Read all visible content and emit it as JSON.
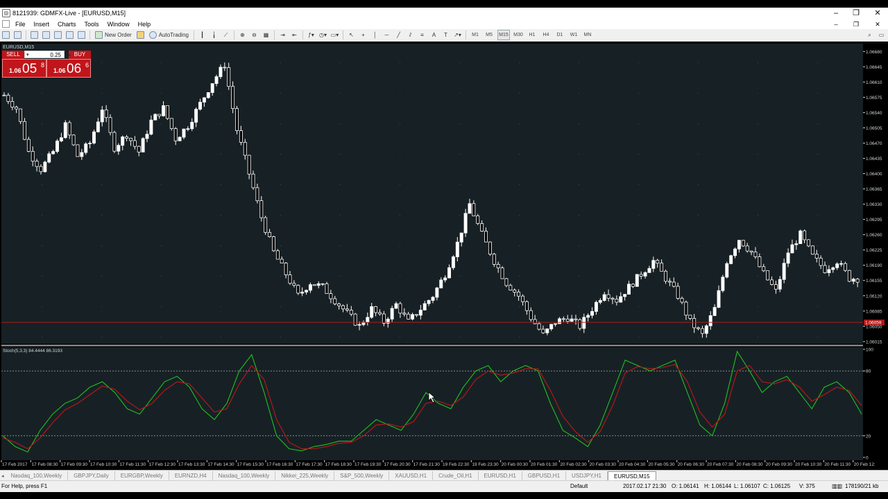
{
  "window": {
    "title": "8121939: GDMFX-Live - [EURUSD,M15]",
    "controls": [
      "–",
      "❐",
      "✕"
    ],
    "doc_controls": [
      "–",
      "❐",
      "✕"
    ]
  },
  "menu": [
    "File",
    "Insert",
    "Charts",
    "Tools",
    "Window",
    "Help"
  ],
  "toolbar": {
    "new_order": "New Order",
    "auto_trading": "AutoTrading",
    "timeframes": [
      "M1",
      "M5",
      "M15",
      "M30",
      "H1",
      "H4",
      "D1",
      "W1",
      "MN"
    ],
    "active_timeframe": "M15"
  },
  "chart": {
    "symbol_label": "EURUSD,M15",
    "indicator_label": "Stoch(5,3,3) 84.4444 86.3193",
    "current_price_label": "1.06059",
    "colors": {
      "background": "#000000",
      "candle_bull": "#ffffff",
      "candle_bear": "#000000",
      "price_line": "#b11a1a",
      "stoch_main": "#22c022",
      "stoch_signal": "#c0161b"
    }
  },
  "one_click": {
    "sell_label": "SELL",
    "buy_label": "BUY",
    "lot": "0.25",
    "sell_small": "1.06",
    "sell_big": "05",
    "sell_sup": "8",
    "buy_small": "1.06",
    "buy_big": "06",
    "buy_sup": "6"
  },
  "chart_data": [
    {
      "type": "candlestick",
      "title": "EURUSD,M15",
      "y_ticks": [
        "1.06680",
        "1.06645",
        "1.06610",
        "1.06575",
        "1.06540",
        "1.06505",
        "1.06470",
        "1.06435",
        "1.06400",
        "1.06365",
        "1.06330",
        "1.06295",
        "1.06260",
        "1.06225",
        "1.06190",
        "1.06155",
        "1.06120",
        "1.06085",
        "1.06050",
        "1.06015"
      ],
      "ylim": [
        1.0601,
        1.0669
      ],
      "x_ticks": [
        "17 Feb 2017",
        "17 Feb 08:30",
        "17 Feb 09:30",
        "17 Feb 10:30",
        "17 Feb 11:30",
        "17 Feb 12:30",
        "17 Feb 13:30",
        "17 Feb 14:30",
        "17 Feb 15:30",
        "17 Feb 16:30",
        "17 Feb 17:30",
        "17 Feb 18:30",
        "17 Feb 19:30",
        "17 Feb 20:30",
        "17 Feb 21:30",
        "19 Feb 22:30",
        "19 Feb 23:30",
        "20 Feb 00:30",
        "20 Feb 01:30",
        "20 Feb 02:30",
        "20 Feb 03:30",
        "20 Feb 04:30",
        "20 Feb 05:30",
        "20 Feb 06:30",
        "20 Feb 07:30",
        "20 Feb 08:30",
        "20 Feb 09:30",
        "20 Feb 10:30",
        "20 Feb 11:30",
        "20 Feb 12:"
      ],
      "current_price": 1.06059,
      "close_path": [
        1.0658,
        1.0655,
        1.0645,
        1.0641,
        1.0645,
        1.0651,
        1.0644,
        1.0647,
        1.0655,
        1.0646,
        1.0649,
        1.0645,
        1.0652,
        1.0655,
        1.0648,
        1.0651,
        1.0656,
        1.0661,
        1.0665,
        1.065,
        1.064,
        1.063,
        1.0622,
        1.0617,
        1.0612,
        1.0615,
        1.0614,
        1.0611,
        1.0608,
        1.0605,
        1.0609,
        1.0606,
        1.061,
        1.0606,
        1.0609,
        1.0612,
        1.0617,
        1.0624,
        1.0633,
        1.0626,
        1.062,
        1.0615,
        1.0612,
        1.0607,
        1.0603,
        1.0606,
        1.0607,
        1.0605,
        1.0609,
        1.0613,
        1.0611,
        1.0614,
        1.0617,
        1.062,
        1.0616,
        1.0612,
        1.0606,
        1.0603,
        1.0609,
        1.062,
        1.0625,
        1.0622,
        1.0617,
        1.0613,
        1.0622,
        1.0626,
        1.0621,
        1.0618,
        1.062,
        1.0616
      ]
    },
    {
      "type": "line",
      "title": "Stoch(5,3,3) 84.4444 86.3193",
      "ylim": [
        0,
        100
      ],
      "y_ticks": [
        "100",
        "80",
        "20",
        "0"
      ],
      "levels": [
        80,
        20
      ],
      "series": [
        {
          "values": [
            20,
            10,
            5,
            25,
            40,
            50,
            55,
            65,
            70,
            60,
            45,
            40,
            55,
            70,
            75,
            65,
            45,
            35,
            50,
            80,
            95,
            60,
            20,
            8,
            6,
            10,
            12,
            15,
            15,
            25,
            35,
            30,
            25,
            40,
            60,
            50,
            45,
            65,
            80,
            85,
            70,
            80,
            85,
            80,
            50,
            25,
            18,
            10,
            30,
            60,
            90,
            85,
            80,
            85,
            90,
            60,
            30,
            20,
            50,
            98,
            80,
            60,
            70,
            75,
            60,
            45,
            65,
            70,
            60,
            40
          ]
        },
        {
          "values": [
            18,
            14,
            8,
            18,
            32,
            44,
            50,
            58,
            66,
            63,
            52,
            44,
            50,
            62,
            70,
            68,
            55,
            42,
            45,
            68,
            85,
            72,
            35,
            14,
            8,
            8,
            10,
            13,
            14,
            20,
            30,
            31,
            28,
            33,
            50,
            52,
            48,
            56,
            72,
            80,
            76,
            78,
            82,
            82,
            62,
            38,
            24,
            14,
            24,
            48,
            78,
            84,
            82,
            83,
            86,
            70,
            42,
            28,
            40,
            80,
            85,
            70,
            68,
            72,
            65,
            52,
            58,
            65,
            62,
            48
          ]
        }
      ]
    }
  ],
  "tabs": [
    "Nasdaq_100,Weekly",
    "GBPJPY,Daily",
    "EURGBP,Weekly",
    "EURNZD,H4",
    "Nasdaq_100,Weekly",
    "Nikkei_225,Weekly",
    "S&P_500,Weekly",
    "XAUUSD,H1",
    "Crude_Oil,H1",
    "EURUSD,H1",
    "GBPUSD,H1",
    "USDJPY,H1",
    "EURUSD,M15"
  ],
  "active_tab": "EURUSD,M15",
  "status": {
    "help": "For Help, press F1",
    "profile": "Default",
    "datetime": "2017.02.17 21:30",
    "open": "O: 1.06141",
    "high": "H: 1.06144",
    "low": "L: 1.06107",
    "close": "C: 1.06125",
    "volume": "V: 375",
    "traffic": "178190/21 kb"
  }
}
